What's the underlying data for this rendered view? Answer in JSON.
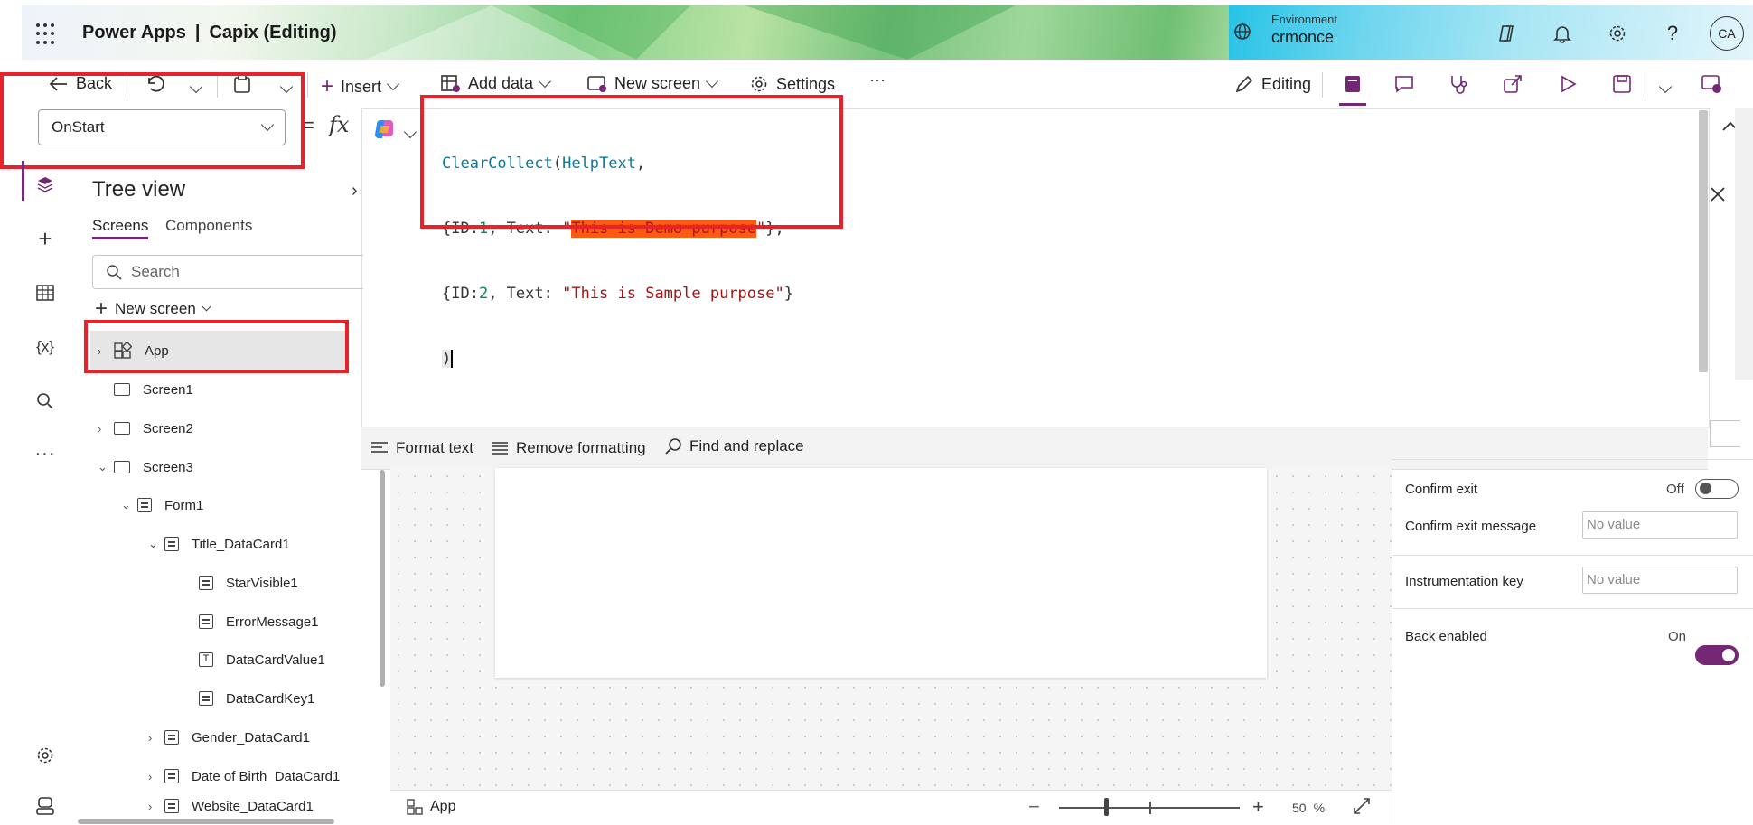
{
  "header": {
    "app_name": "Power Apps",
    "divider": "|",
    "app_title": "Capix (Editing)",
    "environment_label": "Environment",
    "environment_name": "crmonce",
    "avatar_initials": "CA"
  },
  "toolbar": {
    "back": "Back",
    "insert": "Insert",
    "add_data": "Add data",
    "new_screen": "New screen",
    "settings": "Settings",
    "more": "···",
    "editing": "Editing"
  },
  "property_selector": {
    "selected": "OnStart",
    "equals": "=",
    "fx": "fx"
  },
  "formula": {
    "line1_fn": "ClearCollect",
    "line1_paren": "(",
    "line1_arg": "HelpText",
    "line1_comma": ",",
    "line2_pre": "{ID:",
    "line2_num": "1",
    "line2_mid": ", Text: ",
    "line2_quote_open": "\"",
    "line2_str": "This is Demo purpose",
    "line2_quote_close": "\"",
    "line2_end": "},",
    "line3_pre": "{ID:",
    "line3_num": "2",
    "line3_mid": ", Text: ",
    "line3_str": "\"This is Sample purpose\"",
    "line3_end": "}",
    "line4": ")"
  },
  "formula_bar": {
    "format_text": "Format text",
    "remove_formatting": "Remove formatting",
    "find_replace": "Find and replace"
  },
  "tree": {
    "title": "Tree view",
    "tabs": [
      "Screens",
      "Components"
    ],
    "search_placeholder": "Search",
    "new_screen": "New screen",
    "items": [
      {
        "label": "App"
      },
      {
        "label": "Screen1"
      },
      {
        "label": "Screen2"
      },
      {
        "label": "Screen3"
      },
      {
        "label": "Form1"
      },
      {
        "label": "Title_DataCard1"
      },
      {
        "label": "StarVisible1"
      },
      {
        "label": "ErrorMessage1"
      },
      {
        "label": "DataCardValue1"
      },
      {
        "label": "DataCardKey1"
      },
      {
        "label": "Gender_DataCard1"
      },
      {
        "label": "Date of Birth_DataCard1"
      },
      {
        "label": "Website_DataCard1"
      }
    ]
  },
  "properties": {
    "confirm_exit_label": "Confirm exit",
    "confirm_exit_state": "Off",
    "confirm_exit_message_label": "Confirm exit message",
    "confirm_exit_message_placeholder": "No value",
    "instrumentation_key_label": "Instrumentation key",
    "instrumentation_key_placeholder": "No value",
    "back_enabled_label": "Back enabled",
    "back_enabled_state": "On"
  },
  "canvas_footer": {
    "breadcrumb": "App",
    "zoom_value": "50",
    "zoom_unit": "%"
  },
  "colors": {
    "accent": "#742774",
    "highlight_box": "#e8222a",
    "string_highlight": "#ff5a10"
  }
}
